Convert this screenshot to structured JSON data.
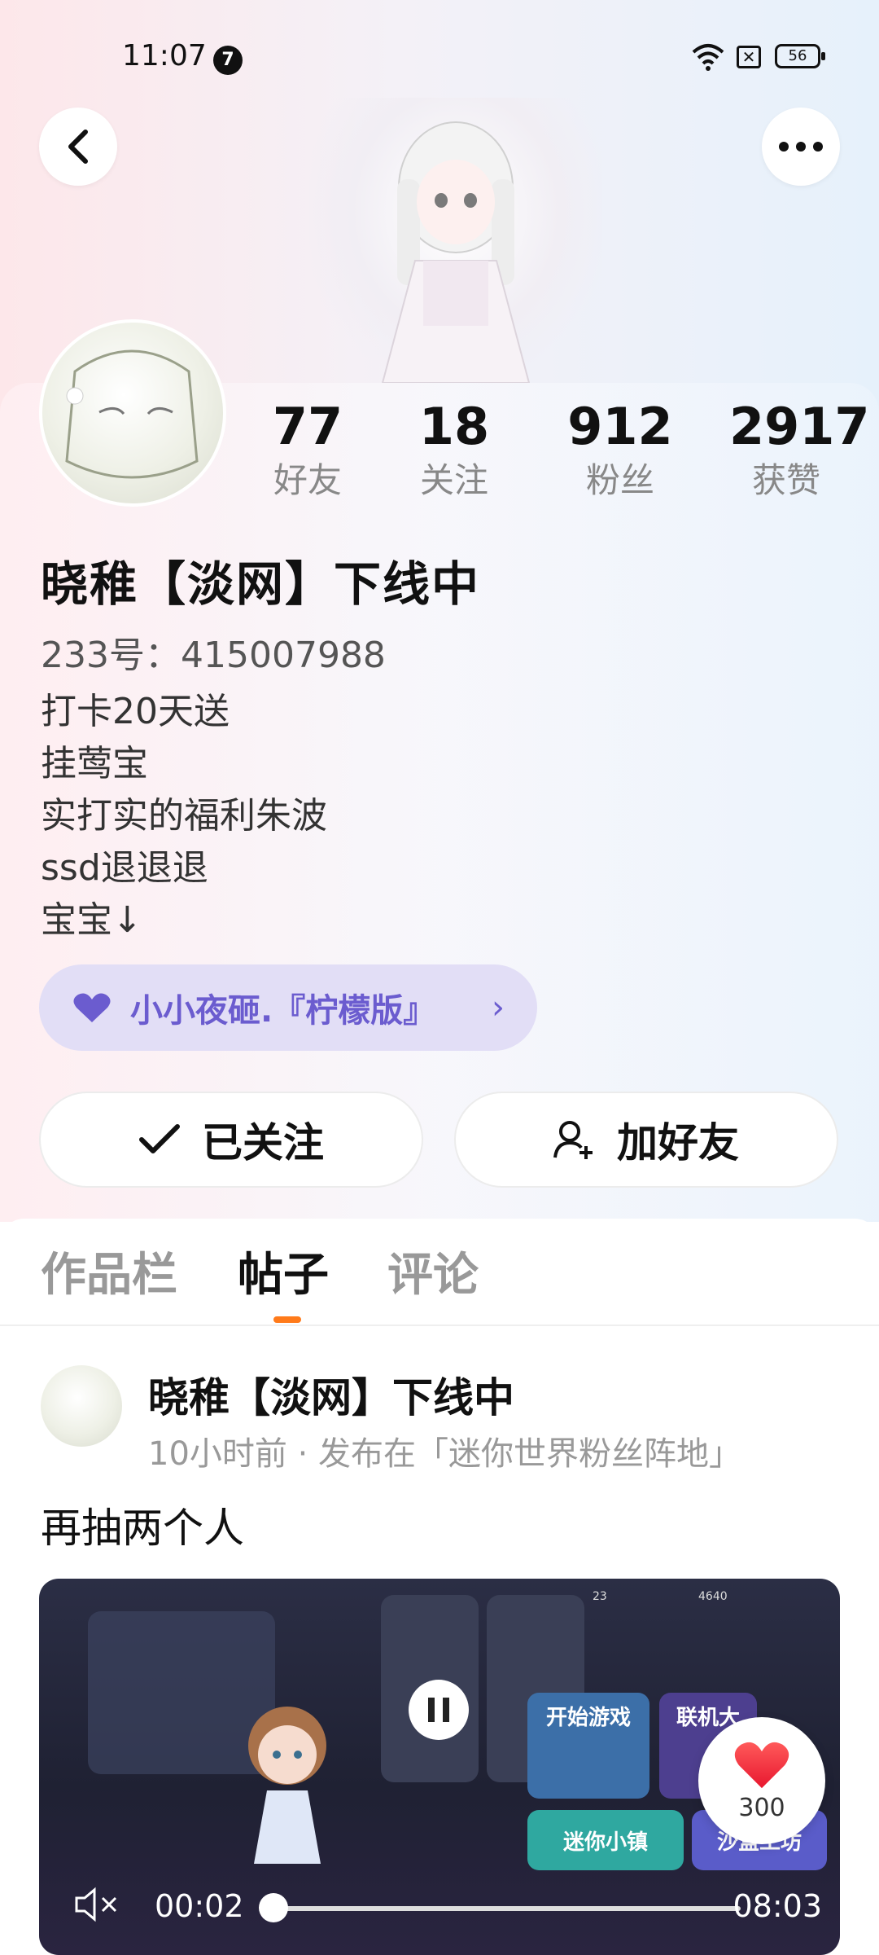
{
  "status_bar": {
    "time": "11:07",
    "notification_count": "7",
    "sim_status": "✕",
    "battery": "56"
  },
  "header": {
    "back_icon": "chevron-left-icon",
    "more_icon": "more-horizontal-icon"
  },
  "profile": {
    "stats": [
      {
        "value": "77",
        "label": "好友"
      },
      {
        "value": "18",
        "label": "关注"
      },
      {
        "value": "912",
        "label": "粉丝"
      },
      {
        "value": "2917",
        "label": "获赞"
      }
    ],
    "name": "晓稚【淡网】下线中",
    "uid": "233号：415007988",
    "bio_lines": [
      "打卡20天送",
      "挂莺宝",
      "实打实的福利朱波",
      "ssd退退退",
      "宝宝↓"
    ],
    "group": {
      "name": "小小夜砸.『柠檬版』",
      "arrow": "›",
      "icon": "heart-icon",
      "color": "#6b5ccf"
    },
    "follow_button": "已关注",
    "add_friend_button": "加好友"
  },
  "tabs": [
    {
      "label": "作品栏",
      "active": false
    },
    {
      "label": "帖子",
      "active": true
    },
    {
      "label": "评论",
      "active": false
    }
  ],
  "accent_color": "#ff7a1a",
  "post": {
    "author": "晓稚【淡网】下线中",
    "meta": "10小时前 · 发布在「迷你世界粉丝阵地」",
    "text": "再抽两个人",
    "video": {
      "current_time": "00:02",
      "total_time": "08:03",
      "progress": 0.004,
      "muted": true,
      "game_buttons": [
        "开始游戏",
        "联机大",
        "迷你小镇",
        "沙盒工坊"
      ],
      "hud_currency_1": "23",
      "hud_currency_2": "4640"
    },
    "likes": "300"
  }
}
